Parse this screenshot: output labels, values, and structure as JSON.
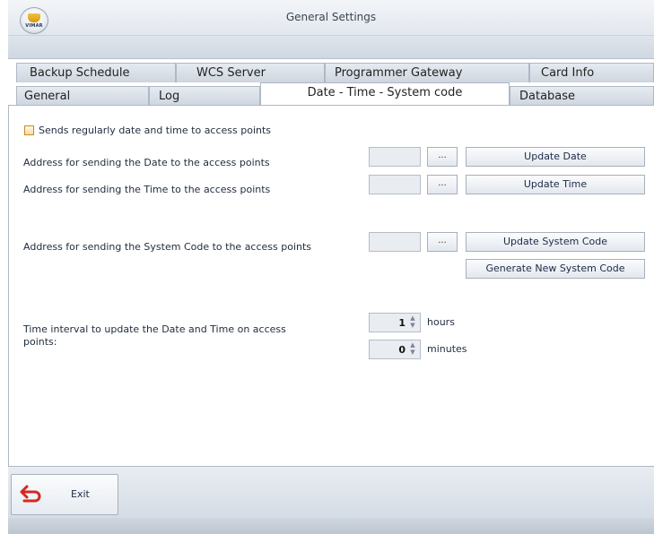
{
  "window": {
    "title": "General Settings",
    "logo_text": "VIMAR",
    "accent_color": "#d4291f"
  },
  "tabs": {
    "row1": [
      "Backup Schedule",
      "WCS Server",
      "Programmer Gateway",
      "Card Info"
    ],
    "row2": [
      "General",
      "Log",
      "Date - Time - System code",
      "Database"
    ],
    "active": "Date - Time - System code"
  },
  "content": {
    "checkbox_label": "Sends regularly date and time to access points",
    "checkbox_checked": false,
    "date_label": "Address for sending the Date to the access points",
    "time_label": "Address for sending the Time to the access points",
    "system_code_label": "Address for sending the System Code to the access points",
    "browse_label": "...",
    "update_date_button": "Update Date",
    "update_time_button": "Update Time",
    "update_system_code_button": "Update System Code",
    "generate_system_code_button": "Generate New System Code",
    "interval_label_line1": "Time interval to update the Date and Time on access",
    "interval_label_line2": "points:",
    "hours_value": "1",
    "hours_unit": "hours",
    "minutes_value": "0",
    "minutes_unit": "minutes"
  },
  "footer": {
    "exit_label": "Exit"
  }
}
